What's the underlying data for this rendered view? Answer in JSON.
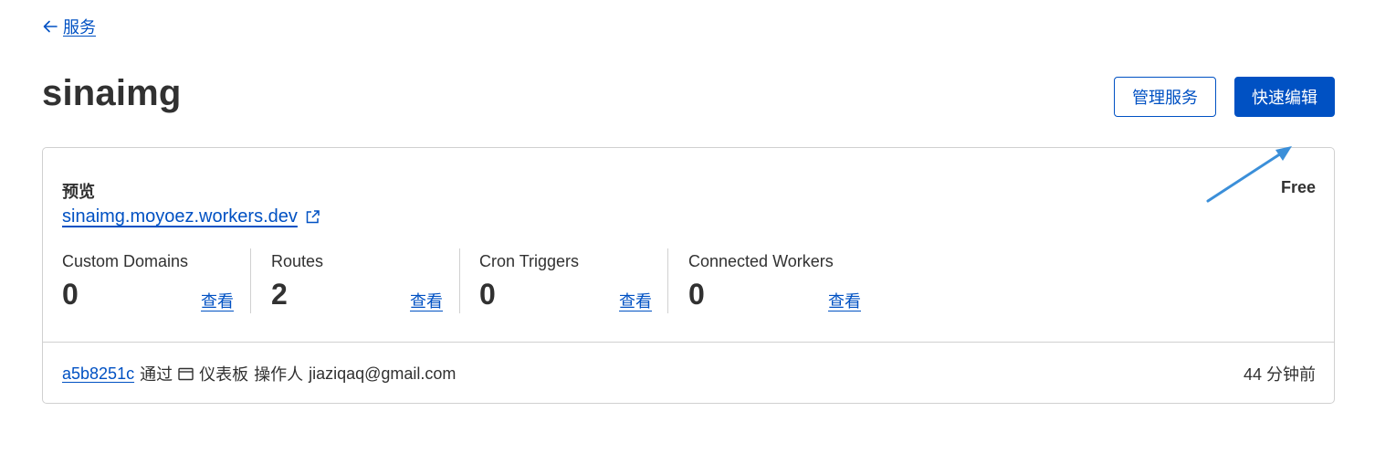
{
  "nav": {
    "back_label": "服务"
  },
  "header": {
    "title": "sinaimg",
    "manage_button": "管理服务",
    "quick_edit_button": "快速编辑"
  },
  "card": {
    "preview_label": "预览",
    "preview_url": "sinaimg.moyoez.workers.dev",
    "plan": "Free",
    "stats": [
      {
        "name": "Custom Domains",
        "count": "0",
        "link": "查看"
      },
      {
        "name": "Routes",
        "count": "2",
        "link": "查看"
      },
      {
        "name": "Cron Triggers",
        "count": "0",
        "link": "查看"
      },
      {
        "name": "Connected Workers",
        "count": "0",
        "link": "查看"
      }
    ],
    "footer": {
      "commit": "a5b8251c",
      "via": "通过",
      "source": "仪表板",
      "operator_label": "操作人",
      "operator": "jiaziqaq@gmail.com",
      "time": "44 分钟前"
    }
  },
  "colors": {
    "accent": "#0051c3",
    "text": "#313131",
    "border": "#d0d0d0",
    "annotation": "#3b8fd9"
  },
  "icons": [
    "arrow-left-icon",
    "external-link-icon",
    "dashboard-icon",
    "annotation-arrow"
  ]
}
